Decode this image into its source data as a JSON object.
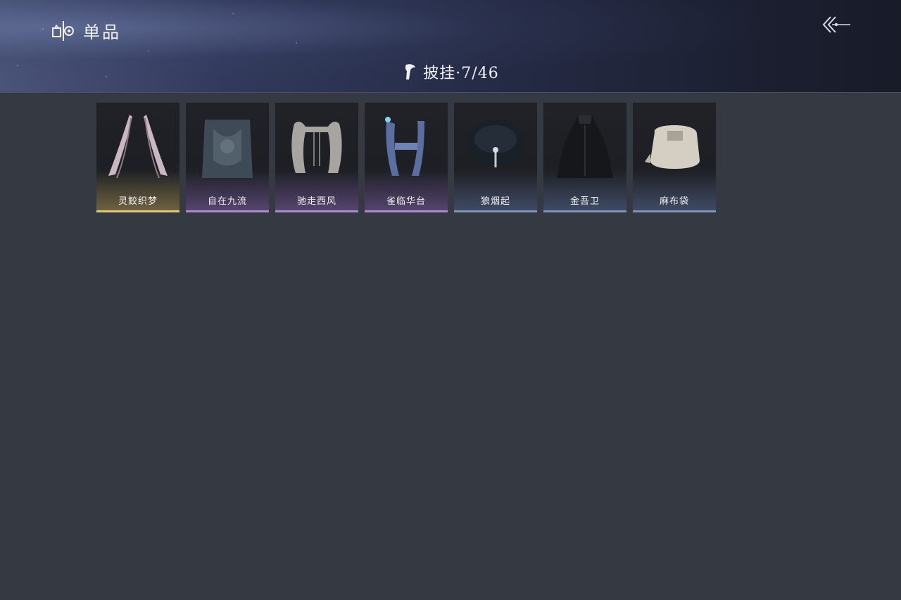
{
  "header": {
    "title": "单品",
    "brand_icon": "wardrobe-icon",
    "back_icon": "back-arrow-icon"
  },
  "category": {
    "icon": "cloak-icon",
    "label": "披挂·7/46"
  },
  "items": [
    {
      "name": "灵鲛织梦",
      "rarity": "gold",
      "art": "ribbon-shawl-icon"
    },
    {
      "name": "自在九流",
      "rarity": "purple",
      "art": "dark-embroidered-cape-icon"
    },
    {
      "name": "驰走西风",
      "rarity": "purple",
      "art": "fur-stole-icon"
    },
    {
      "name": "雀临华台",
      "rarity": "purple",
      "art": "blue-silk-shawl-icon"
    },
    {
      "name": "狼烟起",
      "rarity": "blue",
      "art": "dark-fur-collar-icon"
    },
    {
      "name": "金吾卫",
      "rarity": "blue",
      "art": "black-cloak-icon"
    },
    {
      "name": "麻布袋",
      "rarity": "blue",
      "art": "cloth-sack-icon"
    }
  ],
  "colors": {
    "background": "#353942",
    "gold": "#e0c878",
    "purple": "#a98bcf",
    "blue": "#7f93b8"
  }
}
